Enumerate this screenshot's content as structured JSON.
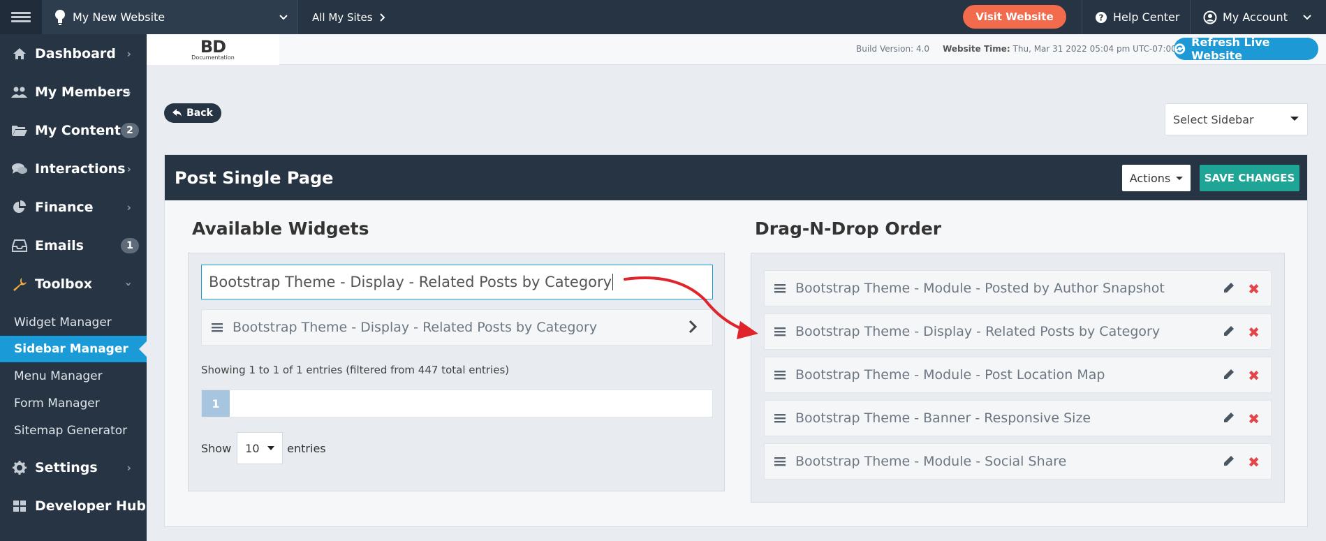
{
  "topbar": {
    "site_name": "My New Website",
    "all_sites": "All My Sites",
    "visit_website": "Visit Website",
    "help_center": "Help Center",
    "my_account": "My Account"
  },
  "sidebar": {
    "items": [
      {
        "label": "Dashboard",
        "icon": "home-icon"
      },
      {
        "label": "My Members",
        "icon": "users-icon"
      },
      {
        "label": "My Content",
        "icon": "folder-icon",
        "badge": "2"
      },
      {
        "label": "Interactions",
        "icon": "chat-icon"
      },
      {
        "label": "Finance",
        "icon": "pie-chart-icon"
      },
      {
        "label": "Emails",
        "icon": "inbox-icon",
        "badge": "1"
      },
      {
        "label": "Toolbox",
        "icon": "wrench-icon"
      },
      {
        "label": "Settings",
        "icon": "gear-icon"
      },
      {
        "label": "Developer Hub",
        "icon": "grid-icon"
      }
    ],
    "toolbox_sub": [
      {
        "label": "Widget Manager"
      },
      {
        "label": "Sidebar Manager",
        "active": true
      },
      {
        "label": "Menu Manager"
      },
      {
        "label": "Form Manager"
      },
      {
        "label": "Sitemap Generator"
      }
    ]
  },
  "header": {
    "logo_main": "BD",
    "logo_sub": "Documentation",
    "build_label": "Build Version:",
    "build_value": "4.0",
    "time_label": "Website Time:",
    "time_value": "Thu, Mar 31 2022 05:04 pm UTC-07:00",
    "refresh_label": "Refresh Live Website"
  },
  "toolbar": {
    "back_label": "Back",
    "select_sidebar": "Select Sidebar"
  },
  "panel": {
    "title": "Post Single Page",
    "actions_label": "Actions",
    "save_label": "SAVE CHANGES"
  },
  "available": {
    "title": "Available Widgets",
    "search_value": "Bootstrap Theme - Display - Related Posts by Category",
    "results": [
      "Bootstrap Theme - Display - Related Posts by Category"
    ],
    "showing": "Showing 1 to 1 of 1 entries (filtered from 447 total entries)",
    "page": "1",
    "show_label": "Show",
    "show_value": "10",
    "entries_label": "entries"
  },
  "order": {
    "title": "Drag-N-Drop Order",
    "items": [
      "Bootstrap Theme - Module - Posted by Author Snapshot",
      "Bootstrap Theme - Display - Related Posts by Category",
      "Bootstrap Theme - Module - Post Location Map",
      "Bootstrap Theme - Banner - Responsive Size",
      "Bootstrap Theme - Module - Social Share"
    ]
  },
  "colors": {
    "navy": "#263443",
    "accent_blue": "#1a9ad6",
    "visit_orange": "#f26b4d",
    "save_teal": "#1fa595",
    "delete_red": "#e2464b",
    "annotation_red": "#e0242b"
  }
}
